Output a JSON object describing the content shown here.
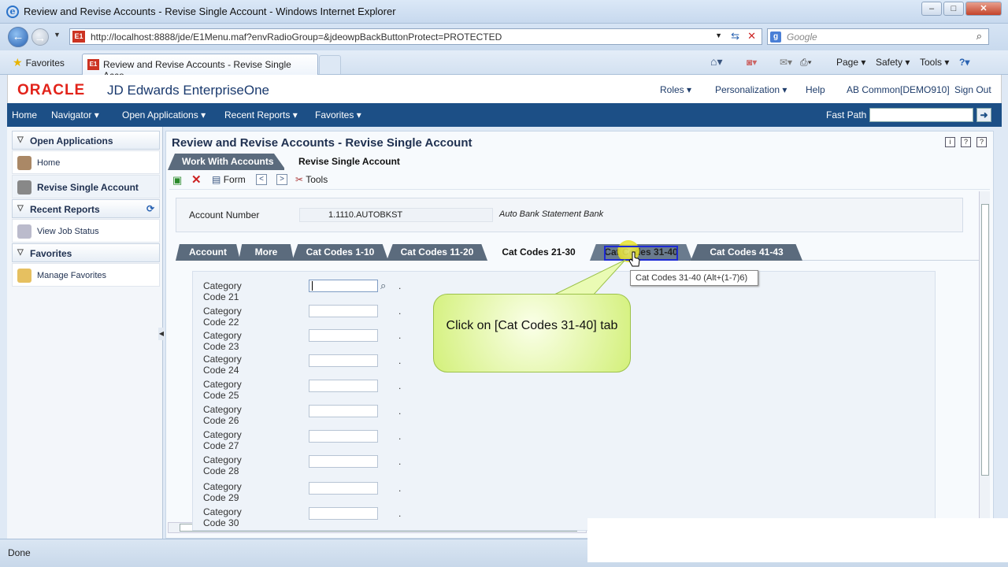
{
  "browser": {
    "window_title": "Review and Revise Accounts - Revise Single Account - Windows Internet Explorer",
    "url": "http://localhost:8888/jde/E1Menu.maf?envRadioGroup=&jdeowpBackButtonProtect=PROTECTED",
    "search_placeholder": "Google",
    "favorites_label": "Favorites",
    "tab_title": "Review and Revise Accounts - Revise Single Acco...",
    "commands": {
      "page": "Page",
      "safety": "Safety",
      "tools": "Tools"
    },
    "status": "Done"
  },
  "jde": {
    "oracle_logo": "ORACLE",
    "product": "JD Edwards EnterpriseOne",
    "header_links": {
      "roles": "Roles",
      "personalization": "Personalization",
      "help": "Help",
      "environment": "AB Common",
      "demo": "[DEMO910]",
      "signout": "Sign Out"
    },
    "nav": {
      "home": "Home",
      "navigator": "Navigator",
      "open_apps": "Open Applications",
      "recent_reports": "Recent Reports",
      "favorites": "Favorites",
      "fast_path": "Fast Path"
    }
  },
  "sidebar": {
    "open_apps_title": "Open Applications",
    "home": "Home",
    "revise": "Revise Single Account",
    "recent_reports_title": "Recent Reports",
    "view_job_status": "View Job Status",
    "favorites_title": "Favorites",
    "manage_favorites": "Manage Favorites"
  },
  "form": {
    "title": "Review and Revise Accounts - Revise Single Account",
    "tab_work": "Work With Accounts",
    "tab_revise": "Revise Single Account",
    "toolbar_form": "Form",
    "toolbar_tools": "Tools",
    "account_number_label": "Account Number",
    "account_number_value": "1.1110.AUTOBKST",
    "account_description": "Auto Bank Statement Bank",
    "tabs": [
      "Account",
      "More",
      "Cat Codes 1-10",
      "Cat Codes 11-20",
      "Cat Codes 21-30",
      "Cat Codes 31-40",
      "Cat Codes 41-43"
    ],
    "categories": [
      "Category Code 21",
      "Category Code 22",
      "Category Code 23",
      "Category Code 24",
      "Category Code 25",
      "Category Code 26",
      "Category Code 27",
      "Category Code 28",
      "Category Code 29",
      "Category Code 30"
    ],
    "tooltip": "Cat Codes 31-40 (Alt+(1-7)6)"
  },
  "callout": {
    "text": "Click on [Cat Codes 31-40] tab"
  }
}
